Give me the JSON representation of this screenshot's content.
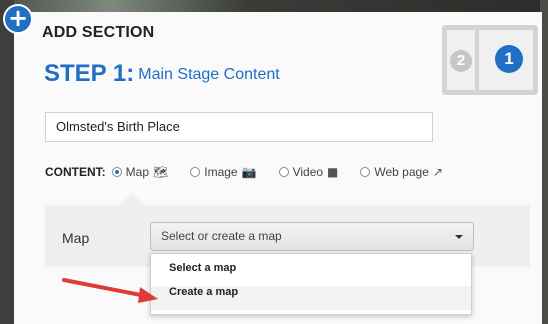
{
  "dialog": {
    "title": "ADD SECTION",
    "step_number": "STEP 1:",
    "step_label": "Main Stage Content",
    "add_icon": "plus-icon",
    "layout_steps": [
      "2",
      "1"
    ]
  },
  "form": {
    "title_value": "Olmsted's Birth Place",
    "content_label": "CONTENT:",
    "content_options": [
      {
        "label": "Map",
        "icon": "map-icon",
        "glyph": "🗺",
        "selected": true
      },
      {
        "label": "Image",
        "icon": "camera-icon",
        "glyph": "📷",
        "selected": false
      },
      {
        "label": "Video",
        "icon": "video-camera-icon",
        "glyph": "■",
        "selected": false
      },
      {
        "label": "Web page",
        "icon": "external-link-icon",
        "glyph": "↗",
        "selected": false
      }
    ]
  },
  "map_section": {
    "label": "Map",
    "select_placeholder": "Select or create a map",
    "dropdown_items": [
      "Select a map",
      "Create a map"
    ],
    "highlighted_item": "Create a map"
  },
  "colors": {
    "accent": "#1f6fc5",
    "arrow": "#e03a3a"
  }
}
